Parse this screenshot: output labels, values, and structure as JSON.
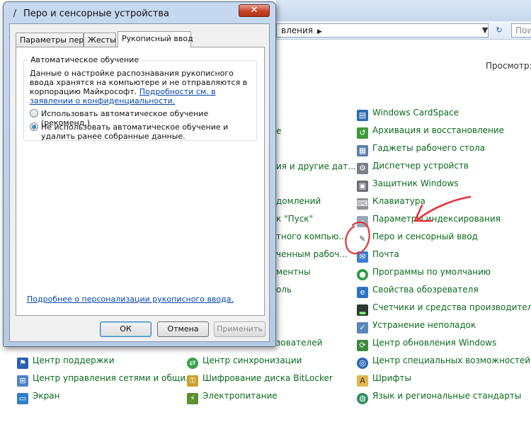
{
  "control_panel": {
    "address_text": "вления",
    "search_placeholder": "Поис",
    "view_by_label": "Просмотр:",
    "left_cut_labels": [
      "е",
      "ия и другие дат...",
      "домлений",
      "к \"Пуск\"",
      "тного компью...",
      "ченным рабоч...",
      "ментны",
      "оль",
      "зователей"
    ],
    "right_column": [
      {
        "label": "Windows CardSpace",
        "icon": "cardspace-icon"
      },
      {
        "label": "Архивация и восстановление",
        "icon": "backup-icon"
      },
      {
        "label": "Гаджеты рабочего стола",
        "icon": "gadgets-icon"
      },
      {
        "label": "Диспетчер устройств",
        "icon": "device-manager-icon"
      },
      {
        "label": "Защитник Windows",
        "icon": "defender-icon"
      },
      {
        "label": "Клавиатура",
        "icon": "keyboard-icon"
      },
      {
        "label": "Параметры индексирования",
        "icon": "indexing-icon"
      },
      {
        "label": "Перо и сенсорный ввод",
        "icon": "pen-icon"
      },
      {
        "label": "Почта",
        "icon": "mail-icon"
      },
      {
        "label": "Программы по умолчанию",
        "icon": "default-programs-icon"
      },
      {
        "label": "Свойства обозревателя",
        "icon": "internet-options-icon"
      },
      {
        "label": "Счетчики и средства производител...",
        "icon": "performance-icon"
      },
      {
        "label": "Устранение неполадок",
        "icon": "troubleshooting-icon"
      },
      {
        "label": "Центр обновления Windows",
        "icon": "windows-update-icon"
      },
      {
        "label": "Центр специальных возможностей",
        "icon": "ease-of-access-icon"
      },
      {
        "label": "Шрифты",
        "icon": "fonts-icon"
      },
      {
        "label": "Язык и региональные стандарты",
        "icon": "region-language-icon"
      }
    ],
    "bottom_left": [
      {
        "label": "Центр поддержки",
        "icon": "action-center-icon"
      },
      {
        "label": "Центр управления сетями и общи...",
        "icon": "network-center-icon"
      },
      {
        "label": "Экран",
        "icon": "display-icon"
      }
    ],
    "bottom_middle": [
      {
        "label": "Центр синхронизации",
        "icon": "sync-center-icon"
      },
      {
        "label": "Шифрование диска BitLocker",
        "icon": "bitlocker-icon"
      },
      {
        "label": "Электропитание",
        "icon": "power-options-icon"
      }
    ]
  },
  "dialog": {
    "title": "Перо и сенсорные устройства",
    "close_symbol": "✕",
    "tabs": [
      {
        "label": "Параметры пера"
      },
      {
        "label": "Жесты"
      },
      {
        "label": "Рукописный ввод"
      }
    ],
    "group_label": "Автоматическое обучение",
    "group_description": "Данные о настройке распознавания рукописного ввода хранятся на компьютере и не отправляются в корпорацию Майкрософт. ",
    "group_link": "Подробности см. в заявлении о конфиденциальности.",
    "radio_1": "Использовать автоматическое обучение (рекоменд.)",
    "radio_2": "Не использовать автоматическое обучение и удалить ранее собранные данные.",
    "personalize_link": "Подробнее о персонализации рукописного ввода.",
    "ok_label": "ОК",
    "cancel_label": "Отмена",
    "apply_label": "Применить"
  },
  "colors": {
    "link_green": "#0b6b1d",
    "link_blue": "#0645ad",
    "annotation_red": "#e8333a"
  }
}
